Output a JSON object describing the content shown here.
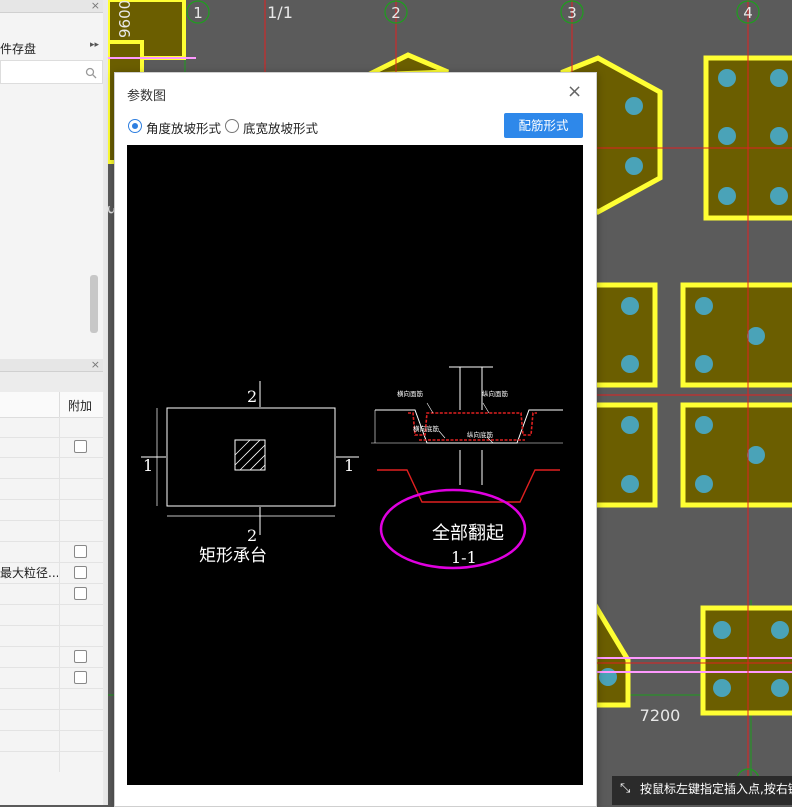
{
  "left_panel": {
    "top_title": "件存盘",
    "top_expand": "▸▸",
    "search_icon": "search-icon",
    "close_glyph": "×",
    "property_column": "附加",
    "property_text": "最大粒径..."
  },
  "canvas": {
    "axes_top": [
      "1",
      "1/1",
      "2",
      "3",
      "4"
    ],
    "dimension_vertical": "9600",
    "dimension_bottom": "7200"
  },
  "dialog": {
    "title": "参数图",
    "close_glyph": "×",
    "radio_angle": "角度放坡形式",
    "radio_width": "底宽放坡形式",
    "rebar_button": "配筋形式",
    "plan_caption": "矩形承台",
    "section_mark_1": "1",
    "section_mark_2": "2",
    "section_note": "全部翻起",
    "section_caption": "1-1",
    "small_labels": {
      "top_horizontal": "横向面筋",
      "top_longitudinal": "纵向面筋",
      "bottom_horizontal": "横向底筋",
      "bottom_longitudinal": "纵向底筋"
    }
  },
  "status_bar": {
    "text": "按鼠标左键指定插入点,按右键"
  },
  "colors": {
    "footing_fill": "#6b5e00",
    "footing_border": "#ffff33",
    "pile_fill": "#4aa3b8",
    "axis_red": "#e02020",
    "grid_green": "#1e9e1e",
    "highlight_magenta": "#e000e0",
    "button_blue": "#2e88ea"
  }
}
